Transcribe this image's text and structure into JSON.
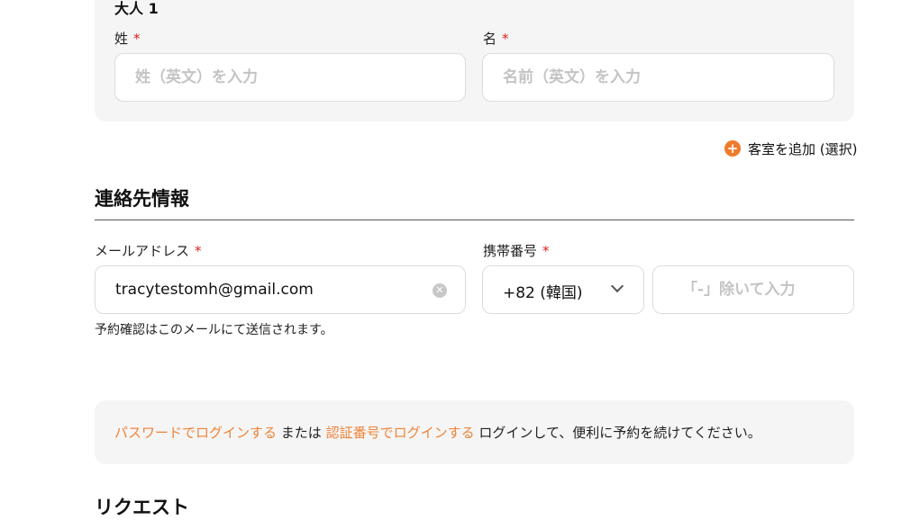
{
  "guest": {
    "title": "大人 1",
    "last_name": {
      "label": "姓",
      "required_mark": "*",
      "placeholder": "姓（英文）を入力",
      "value": ""
    },
    "first_name": {
      "label": "名",
      "required_mark": "*",
      "placeholder": "名前（英文）を入力",
      "value": ""
    }
  },
  "add_room": {
    "icon": "plus-icon",
    "label": "客室を追加 (選択)"
  },
  "contact": {
    "title": "連絡先情報",
    "email": {
      "label": "メールアドレス",
      "required_mark": "*",
      "value": "tracytestomh@gmail.com",
      "clear_icon": "clear-icon"
    },
    "phone": {
      "label": "携帯番号",
      "required_mark": "*",
      "country_code": "+82 (韓国)",
      "placeholder": "「-」除いて入力",
      "value": ""
    },
    "note": "予約確認はこのメールにて送信されます。"
  },
  "login": {
    "password_link": "パスワードでログインする",
    "or_text": "または",
    "code_link": "認証番号でログインする",
    "message": "ログインして、便利に予約を続けてください。"
  },
  "next_section": {
    "title": "リクエスト"
  },
  "colors": {
    "accent": "#ef8336",
    "required": "#e02020",
    "card_bg": "#f5f5f5"
  }
}
